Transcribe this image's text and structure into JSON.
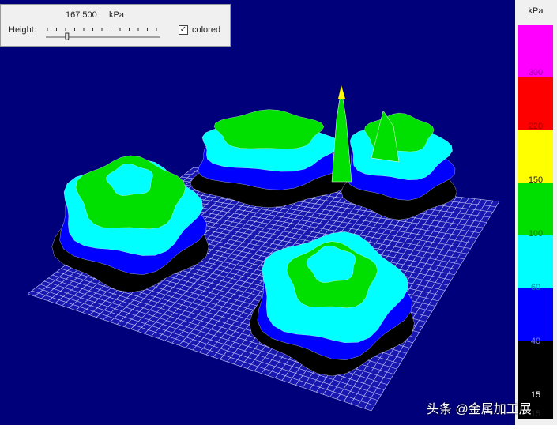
{
  "panel": {
    "height_label": "Height:",
    "height_value": "167.500",
    "height_unit": "kPa",
    "colored_label": "colored",
    "colored_checked": true,
    "slider_fraction": 0.18
  },
  "legend": {
    "unit": "kPa",
    "labels": [
      "300",
      "220",
      "150",
      "100",
      "60",
      "40",
      "15",
      "15"
    ],
    "bands": [
      "#ff00ff",
      "#ff0000",
      "#ffff00",
      "#00e000",
      "#00ffff",
      "#0000ff",
      "#000000"
    ]
  },
  "chart_data": {
    "type": "surface",
    "title": "",
    "zlabel": "kPa",
    "colorscale": [
      {
        "min": 15,
        "max": 40,
        "color": "#000000"
      },
      {
        "min": 40,
        "max": 60,
        "color": "#0000ff"
      },
      {
        "min": 60,
        "max": 100,
        "color": "#00ffff"
      },
      {
        "min": 100,
        "max": 150,
        "color": "#00e000"
      },
      {
        "min": 150,
        "max": 220,
        "color": "#ffff00"
      },
      {
        "min": 220,
        "max": 300,
        "color": "#ff0000"
      },
      {
        "min": 300,
        "max": null,
        "color": "#ff00ff"
      }
    ]
  },
  "watermark": "头条 @金属加工展"
}
